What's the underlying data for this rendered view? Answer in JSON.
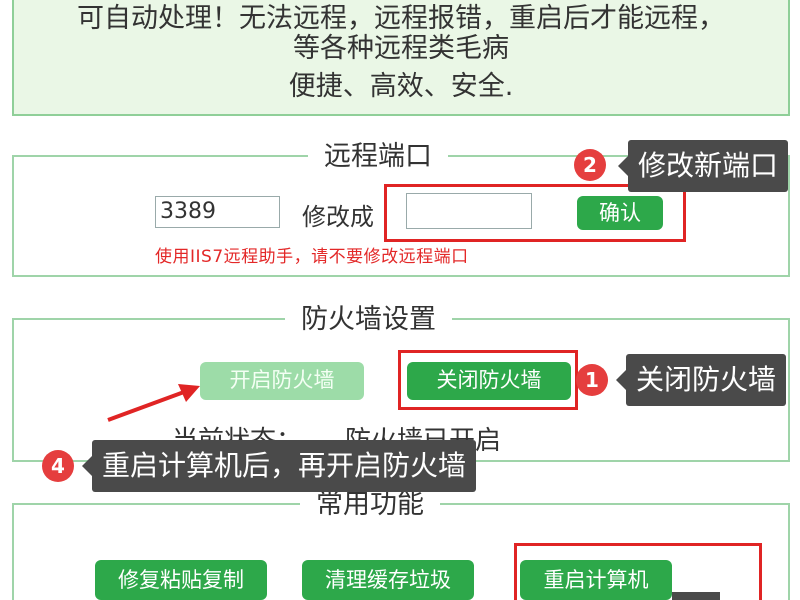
{
  "intro": {
    "line1": "可自动处理！无法远程，远程报错，重启后才能远程，",
    "line2": "等各种远程类毛病",
    "line3": "便捷、高效、安全."
  },
  "port_section": {
    "title": "远程端口",
    "current_port": "3389",
    "change_label": "修改成",
    "new_port_value": "",
    "confirm_label": "确认",
    "warning": "使用IIS7远程助手，请不要修改远程端口"
  },
  "firewall_section": {
    "title": "防火墙设置",
    "enable_label": "开启防火墙",
    "disable_label": "关闭防火墙",
    "status_prefix": "当前状态：",
    "status_value": "防火墙已开启"
  },
  "functions_section": {
    "title": "常用功能",
    "buttons": [
      "修复粘贴复制",
      "清理缓存垃圾",
      "重启计算机"
    ]
  },
  "annotations": {
    "step1": {
      "number": "1",
      "text": "关闭防火墙"
    },
    "step2": {
      "number": "2",
      "text": "修改新端口"
    },
    "step4": {
      "number": "4",
      "text": "重启计算机后，再开启防火墙"
    }
  },
  "colors": {
    "button_green": "#2da84a",
    "button_disabled": "#9ddca8",
    "panel_border": "#9fd4a9",
    "highlight_red": "#e02424",
    "callout_bg": "#4a4a4a",
    "warning_text": "#e32828"
  }
}
